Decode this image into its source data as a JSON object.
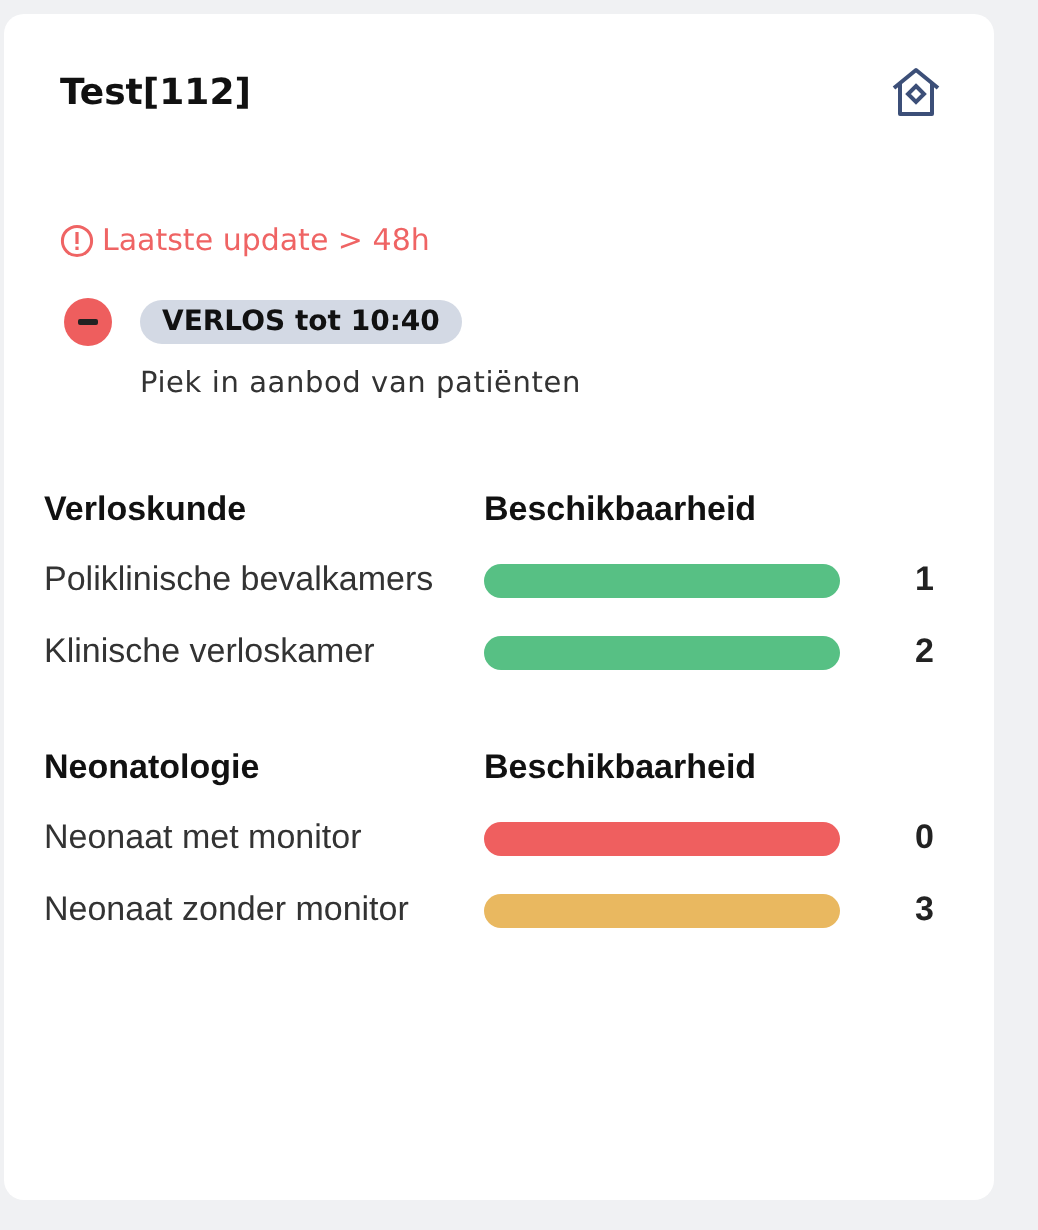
{
  "card": {
    "title": "Test[112]",
    "warning": "Laatste update > 48h",
    "status": {
      "badge": "VERLOS tot 10:40",
      "reason": "Piek in aanbod van patiënten"
    },
    "sections": [
      {
        "title": "Verloskunde",
        "column": "Beschikbaarheid",
        "rows": [
          {
            "name": "Poliklinische bevalkamers",
            "color": "#57c084",
            "value": "1"
          },
          {
            "name": "Klinische verloskamer",
            "color": "#57c084",
            "value": "2"
          }
        ]
      },
      {
        "title": "Neonatologie",
        "column": "Beschikbaarheid",
        "rows": [
          {
            "name": "Neonaat met monitor",
            "color": "#ef5f5f",
            "value": "0"
          },
          {
            "name": "Neonaat zonder monitor",
            "color": "#e9b860",
            "value": "3"
          }
        ]
      }
    ]
  }
}
